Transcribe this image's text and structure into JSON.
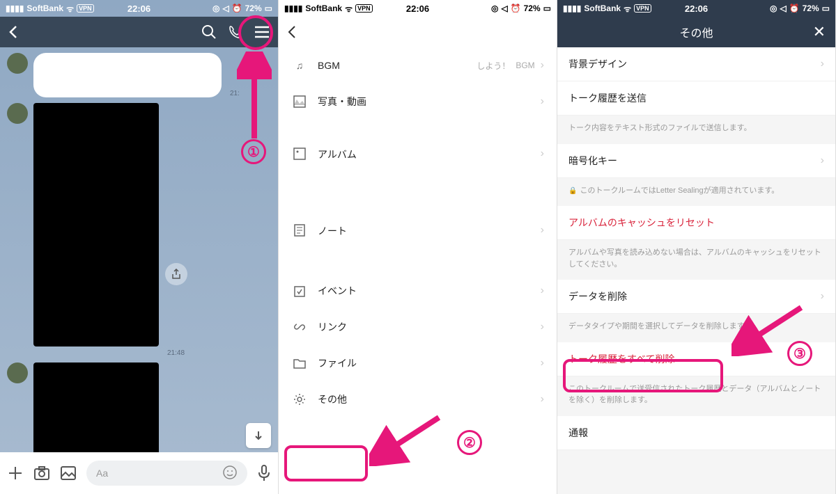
{
  "status": {
    "carrier": "SoftBank",
    "time": "22:06",
    "battery": "72%",
    "vpn": "VPN"
  },
  "panel1": {
    "input_placeholder": "Aa",
    "ts1": "21:",
    "ts2": "21:48"
  },
  "panel2": {
    "items": {
      "bgm": "BGM",
      "bgm_extra1": "しよう！",
      "bgm_extra2": "BGM",
      "photo": "写真・動画",
      "album": "アルバム",
      "note": "ノート",
      "event": "イベント",
      "link": "リンク",
      "file": "ファイル",
      "other": "その他"
    }
  },
  "panel3": {
    "title": "その他",
    "bg_design": "背景デザイン",
    "send_history": "トーク履歴を送信",
    "send_history_desc": "トーク内容をテキスト形式のファイルで送信します。",
    "encryption": "暗号化キー",
    "encryption_desc": "このトークルームではLetter Sealingが適用されています。",
    "album_reset": "アルバムのキャッシュをリセット",
    "album_reset_desc": "アルバムや写真を読み込めない場合は、アルバムのキャッシュをリセットしてください。",
    "delete_data": "データを削除",
    "delete_data_desc": "データタイプや期間を選択してデータを削除します。",
    "delete_all": "トーク履歴をすべて削除",
    "delete_all_desc": "このトークルームで送受信されたトーク履歴とデータ（アルバムとノートを除く）を削除します。",
    "report": "通報"
  },
  "annot": {
    "n1": "①",
    "n2": "②",
    "n3": "③"
  }
}
